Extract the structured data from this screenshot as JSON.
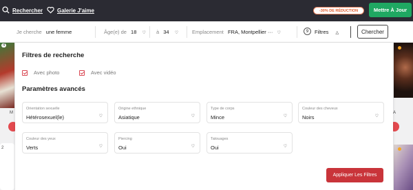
{
  "nav": {
    "search_label": "Rechercher",
    "gallery_label": "Galerie J'aime",
    "promo": "-30% DE RÉDUCTION",
    "upgrade_label": "Mettre À Jour"
  },
  "search_bar": {
    "seeking_label": "Je cherche",
    "seeking_value": "une femme",
    "age_label": "Âge(e) de",
    "age_from": "18",
    "age_to_label": "à",
    "age_to": "34",
    "location_label": "Emplacement",
    "location_value": "FRA, Montpellier ···",
    "filters_count": "9",
    "filters_label": "Filtres",
    "search_button": "Chercher"
  },
  "background": {
    "left_badge": "4",
    "left_badge2": "2",
    "left_letter": "M",
    "right_letter": "A"
  },
  "filters": {
    "title": "Filtres de recherche",
    "checkboxes": [
      {
        "label": "Avec photo",
        "checked": true
      },
      {
        "label": "Avec vidéo",
        "checked": true
      }
    ],
    "advanced_title": "Paramètres avancés",
    "fields": [
      {
        "label": "Orientation sexuelle",
        "value": "Hétérosexuel(le)"
      },
      {
        "label": "Origine ethnique",
        "value": "Asiatique"
      },
      {
        "label": "Type de corps",
        "value": "Mince"
      },
      {
        "label": "Couleur des cheveux",
        "value": "Noirs"
      },
      {
        "label": "Couleur des yeux",
        "value": "Verts"
      },
      {
        "label": "Piercing",
        "value": "Oui"
      },
      {
        "label": "Tatouages",
        "value": "Oui"
      }
    ],
    "apply_button": "Appliquer Les Filtres"
  },
  "colors": {
    "nav_bg": "#2b2b33",
    "upgrade": "#1fa862",
    "promo": "#e25d2f",
    "accent": "#c9343a"
  }
}
